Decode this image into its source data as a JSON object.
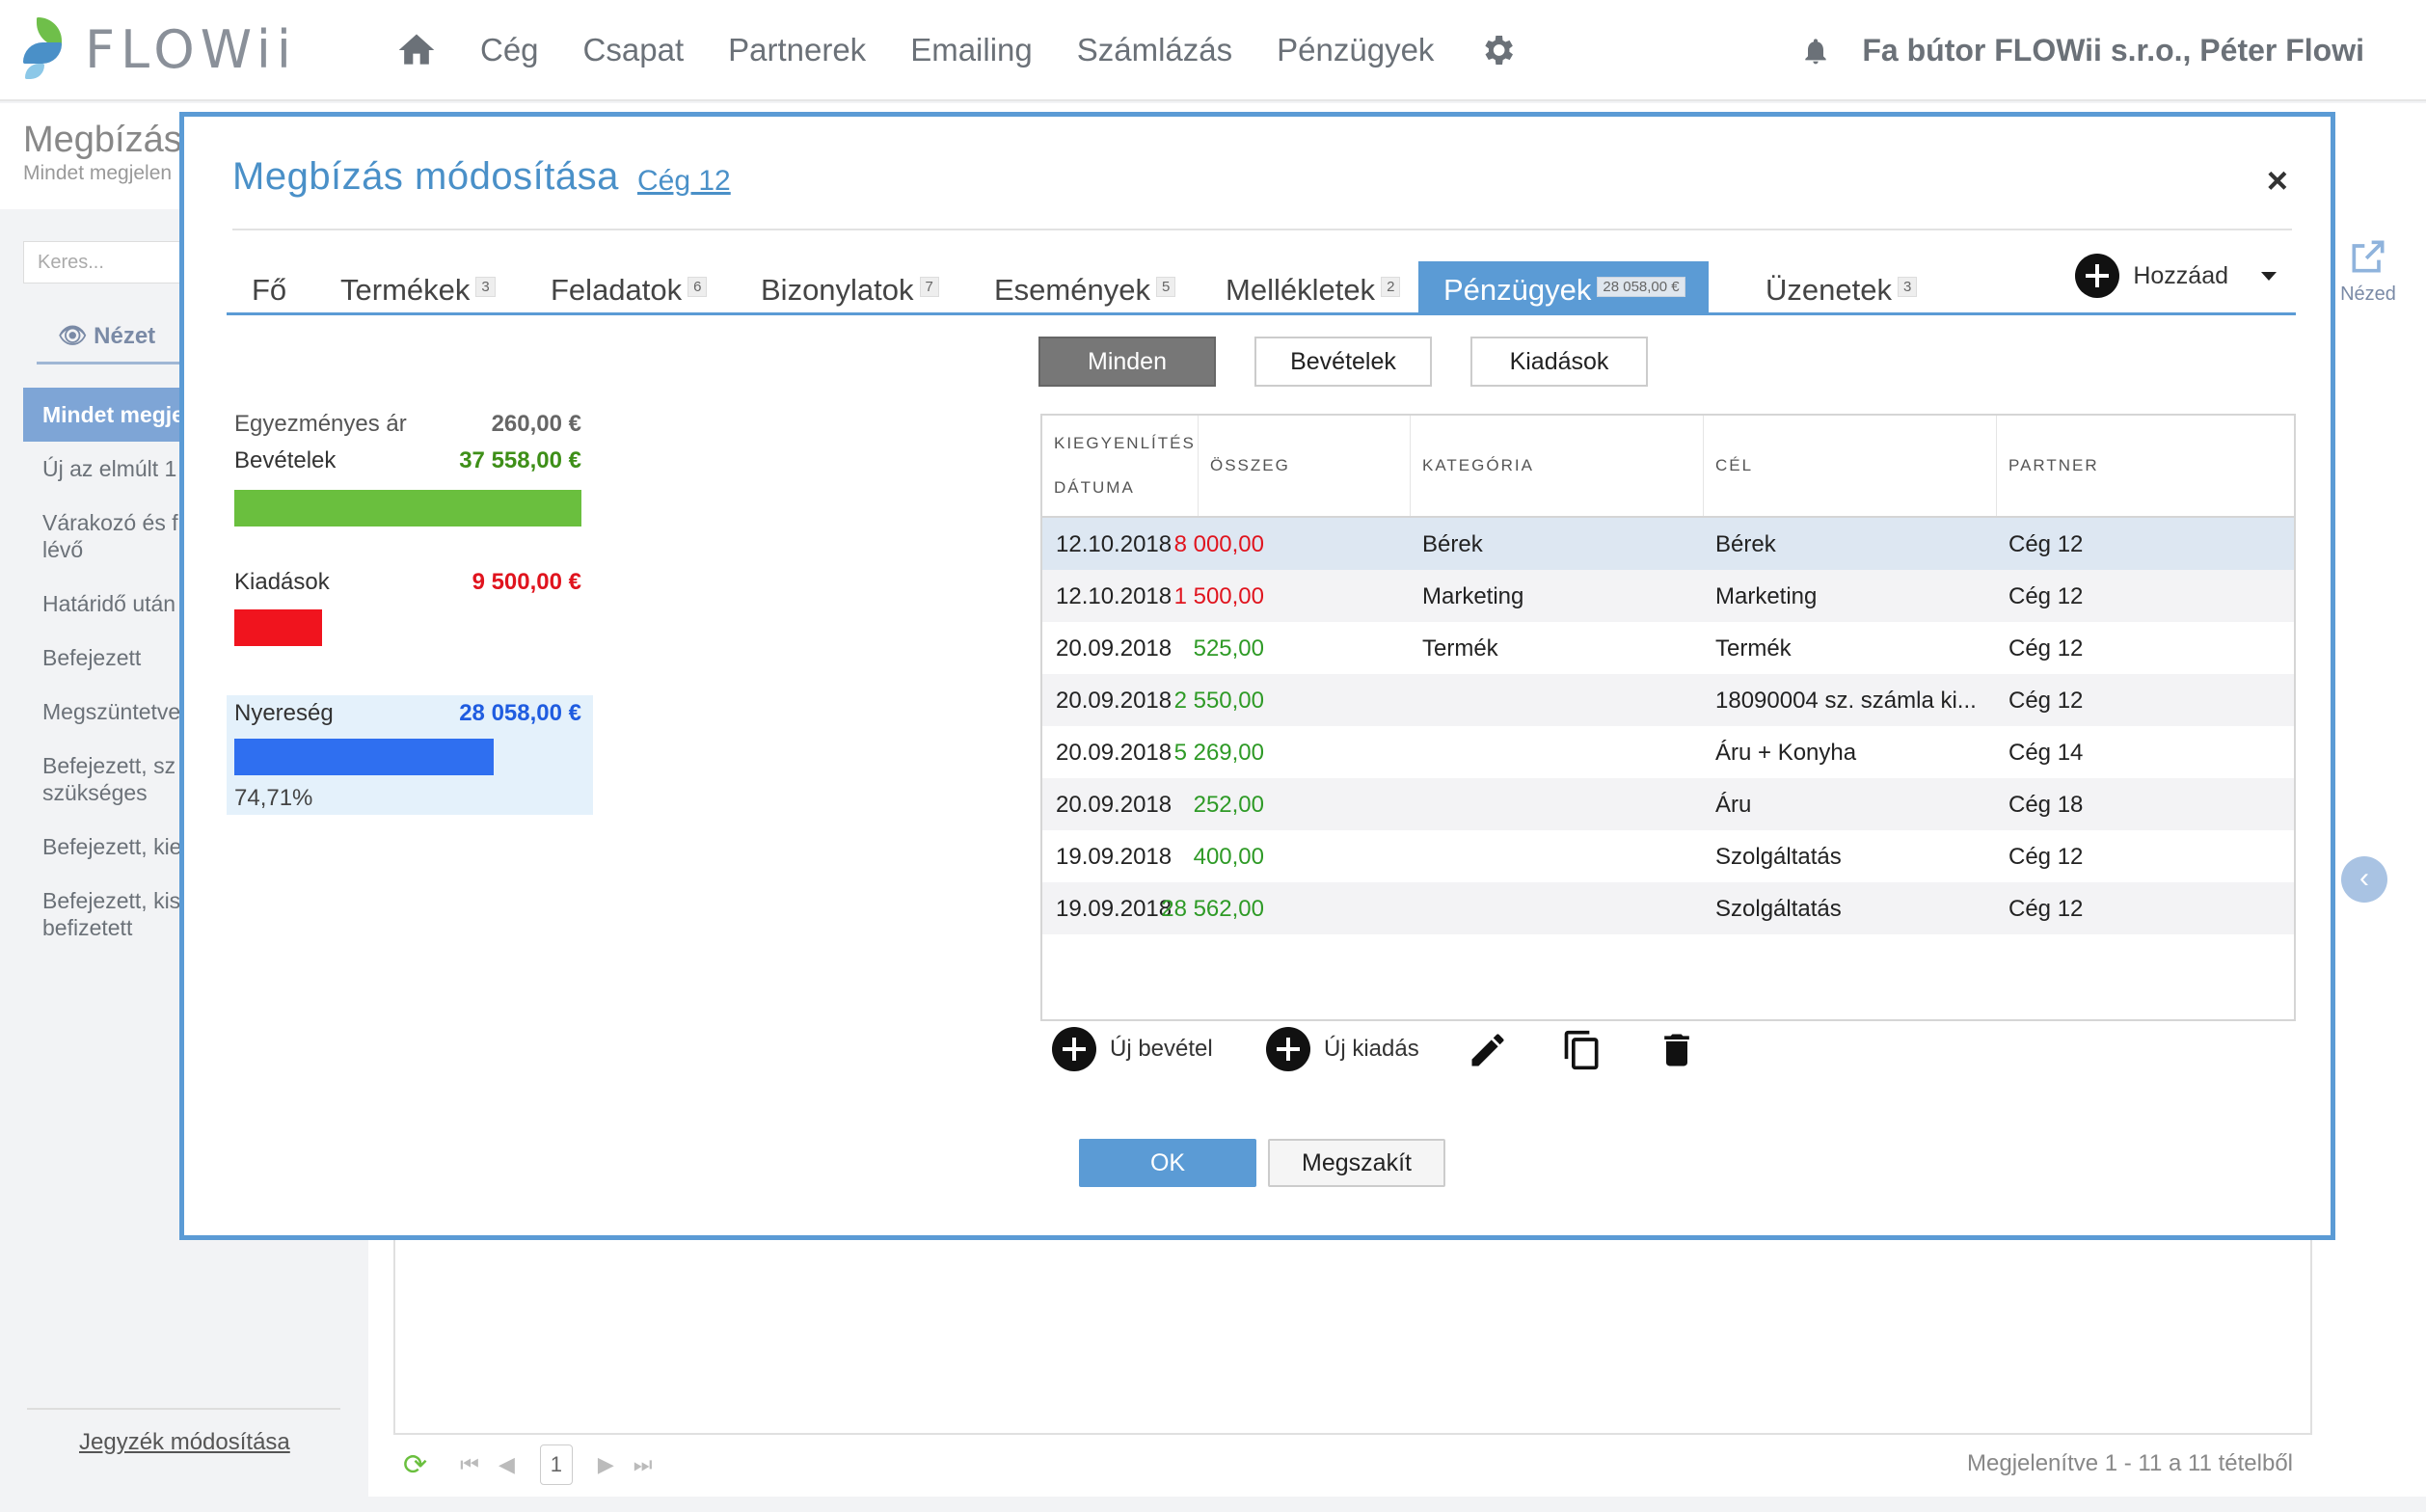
{
  "app": {
    "logo_text": "FLOWii"
  },
  "nav": {
    "items": [
      "Cég",
      "Csapat",
      "Partnerek",
      "Emailing",
      "Számlázás",
      "Pénzügyek"
    ],
    "user": "Fa bútor FLOWii s.r.o., Péter Flowi"
  },
  "background": {
    "title": "Megbízás",
    "subtitle": "Mindet megjelen",
    "search_placeholder": "Keres...",
    "view_label": "Nézet",
    "list": [
      "Mindet megje",
      "Új az elmúlt 1",
      "Várakozó és f lévő",
      "Határidő után",
      "Befejezett",
      "Megszüntetve",
      "Befejezett, sz szükséges",
      "Befejezett, kie",
      "Befejezett, kis befizetett"
    ],
    "footer_link": "Jegyzék módosítása",
    "page_number": "1",
    "records_label": "Megjelenítve 1 - 11 a 11 tételből",
    "right_tool_label": "Nézed"
  },
  "modal": {
    "title": "Megbízás módosítása",
    "company_link": "Cég 12",
    "close": "×",
    "tabs": [
      {
        "label": "Fő",
        "count": ""
      },
      {
        "label": "Termékek",
        "count": "3"
      },
      {
        "label": "Feladatok",
        "count": "6"
      },
      {
        "label": "Bizonylatok",
        "count": "7"
      },
      {
        "label": "Események",
        "count": "5"
      },
      {
        "label": "Mellékletek",
        "count": "2"
      },
      {
        "label": "Pénzügyek",
        "count": "28 058,00 €"
      },
      {
        "label": "Üzenetek",
        "count": "3"
      }
    ],
    "add_label": "Hozzáad",
    "filters": {
      "all": "Minden",
      "income": "Bevételek",
      "expense": "Kiadások"
    },
    "summary": {
      "agreed_label": "Egyezményes ár",
      "agreed_value": "260,00 €",
      "income_label": "Bevételek",
      "income_value": "37 558,00 €",
      "expense_label": "Kiadások",
      "expense_value": "9 500,00 €",
      "profit_label": "Nyereség",
      "profit_value": "28 058,00 €",
      "profit_percent": "74,71%",
      "income_fraction": 1.0,
      "expense_fraction": 0.253,
      "profit_fraction": 0.747,
      "colors": {
        "income": "#6abf3e",
        "expense": "#f0141e",
        "profit": "#2f6ff0"
      }
    },
    "table": {
      "headers": {
        "date_line1": "KIEGYENLÍTÉS",
        "date_line2": "DÁTUMA",
        "amount": "ÖSSZEG",
        "category": "KATEGÓRIA",
        "purpose": "CÉL",
        "partner": "PARTNER"
      },
      "rows": [
        {
          "date": "12.10.2018",
          "amount": "8 000,00",
          "type": "neg",
          "category": "Bérek",
          "purpose": "Bérek",
          "partner": "Cég 12"
        },
        {
          "date": "12.10.2018",
          "amount": "1 500,00",
          "type": "neg",
          "category": "Marketing",
          "purpose": "Marketing",
          "partner": "Cég 12"
        },
        {
          "date": "20.09.2018",
          "amount": "525,00",
          "type": "pos",
          "category": "Termék",
          "purpose": "Termék",
          "partner": "Cég 12"
        },
        {
          "date": "20.09.2018",
          "amount": "2 550,00",
          "type": "pos",
          "category": "",
          "purpose": "18090004 sz. számla ki...",
          "partner": "Cég 12"
        },
        {
          "date": "20.09.2018",
          "amount": "5 269,00",
          "type": "pos",
          "category": "",
          "purpose": "Áru + Konyha",
          "partner": "Cég 14"
        },
        {
          "date": "20.09.2018",
          "amount": "252,00",
          "type": "pos",
          "category": "",
          "purpose": "Áru",
          "partner": "Cég 18"
        },
        {
          "date": "19.09.2018",
          "amount": "400,00",
          "type": "pos",
          "category": "",
          "purpose": "Szolgáltatás",
          "partner": "Cég 12"
        },
        {
          "date": "19.09.2018",
          "amount": "28 562,00",
          "type": "pos",
          "category": "",
          "purpose": "Szolgáltatás",
          "partner": "Cég 12"
        }
      ]
    },
    "actions": {
      "new_income": "Új bevétel",
      "new_expense": "Új kiadás"
    },
    "ok": "OK",
    "cancel": "Megszakít"
  }
}
